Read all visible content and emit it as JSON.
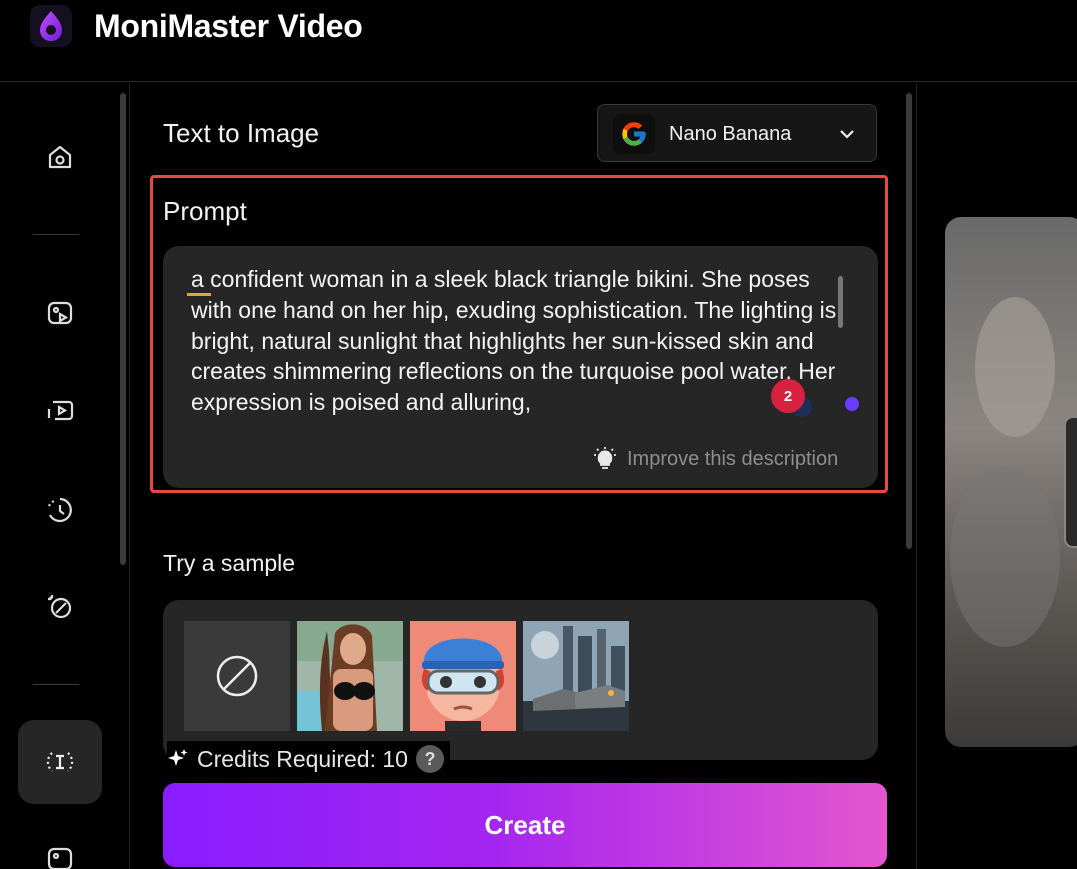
{
  "app": {
    "title": "MoniMaster Video"
  },
  "sidebar": {
    "items": [
      {
        "icon": "home-icon"
      },
      {
        "icon": "image-video-icon"
      },
      {
        "icon": "screen-play-icon"
      },
      {
        "icon": "history-icon"
      },
      {
        "icon": "magic-edit-icon"
      },
      {
        "icon": "text-to-image-icon",
        "active": true
      },
      {
        "icon": "image-sparkle-icon"
      }
    ]
  },
  "panel": {
    "title": "Text to Image",
    "model": {
      "name": "Nano Banana",
      "icon": "google-g-icon"
    },
    "prompt": {
      "label": "Prompt",
      "text": "a confident woman in a sleek black triangle bikini. She poses with one hand on her hip, exuding sophistication. The lighting is bright, natural sunlight that highlights her sun-kissed skin and creates shimmering reflections on the turquoise pool water. Her expression is poised and alluring,",
      "improve_label": "Improve this description"
    },
    "notification_count": "2",
    "sample": {
      "label": "Try a sample",
      "items": [
        {
          "name": "none"
        },
        {
          "name": "bikini-portrait"
        },
        {
          "name": "cartoon-boy-goggles"
        },
        {
          "name": "sci-fi-city-vehicles"
        }
      ]
    },
    "credits": {
      "label": "Credits Required: 10",
      "help": "?"
    },
    "create_label": "Create"
  },
  "colors": {
    "accent_start": "#8a1cff",
    "accent_end": "#e456d0",
    "highlight_border": "#e54a3a",
    "badge": "#d8213f"
  }
}
